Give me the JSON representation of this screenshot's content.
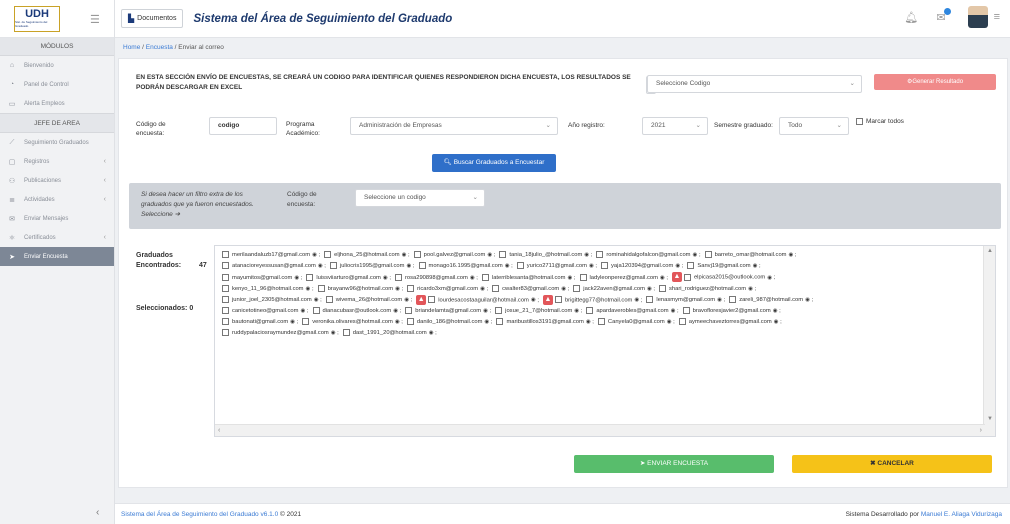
{
  "app": {
    "logo_text": "UDH",
    "logo_sub": "Sist. de Seguimiento del Graduado",
    "title": "Sistema del Área de Seguimiento del Graduado"
  },
  "topbar": {
    "doc_button": "Documentos"
  },
  "sidebar": {
    "header": "MÓDULOS",
    "items": [
      {
        "label": "Bienvenido",
        "icon": "home-icon"
      },
      {
        "label": "Panel de Control",
        "icon": "dashboard-icon"
      },
      {
        "label": "Alerta Empleos",
        "icon": "briefcase-icon"
      }
    ],
    "section": "JEFE DE AREA",
    "area_items": [
      {
        "label": "Seguimiento Graduados",
        "icon": "chart-icon",
        "chev": false
      },
      {
        "label": "Registros",
        "icon": "folder-icon",
        "chev": true
      },
      {
        "label": "Publicaciones",
        "icon": "users-icon",
        "chev": true
      },
      {
        "label": "Actividades",
        "icon": "list-icon",
        "chev": true
      },
      {
        "label": "Enviar Mensajes",
        "icon": "envelope-icon",
        "chev": false
      },
      {
        "label": "Certificados",
        "icon": "certificate-icon",
        "chev": true
      },
      {
        "label": "Enviar Encuesta",
        "icon": "send-icon",
        "chev": false,
        "active": true
      }
    ]
  },
  "breadcrumb": {
    "home": "Home",
    "encuesta": "Encuesta",
    "current": "Enviar al correo"
  },
  "intro": "EN ESTA SECCIÓN ENVÍO DE ENCUESTAS, SE CREARÁ UN CODIGO PARA IDENTIFICAR QUIENES RESPONDIERON DICHA ENCUESTA, LOS RESULTADOS SE PODRÁN DESCARGAR EN EXCEL",
  "codigo_select": "Seleccione Codigo",
  "generar_button": "Generar Resultado",
  "form": {
    "codigo_label": "Código de encuesta:",
    "codigo_value": "codigo",
    "programa_label": "Programa Académico:",
    "programa_value": "Administración de Empresas",
    "anio_label": "Año registro:",
    "anio_value": "2021",
    "semestre_label": "Semestre graduado:",
    "semestre_value": "Todo",
    "marcar_label": "Marcar todos",
    "buscar_button": "Buscar Graduados a Encuestar"
  },
  "filter": {
    "text": "Si desea hacer un filtro extra de los graduados que ya fueron encuestados. Seleccione ➔",
    "label": "Código de encuesta:",
    "select": "Seleccione un codigo"
  },
  "stats": {
    "encontrados_label": "Graduados Encontrados:",
    "encontrados_value": "47",
    "seleccionados_label": "Seleccionados:",
    "seleccionados_value": "0"
  },
  "emails": [
    [
      "merilaandaluzb17@gmail.com",
      "eljhona_25@hotmail.com",
      "pool.galvez@gmail.com",
      "tania_18julio_@hotmail.com",
      "rominahidalgofalcon@gmail.com",
      "barreto_omar@hotmail.com"
    ],
    [
      "atanacioreyessusan@gmail.com",
      "juliocris1995@gmail.com",
      "monago16.1995@gmail.com",
      "yurico2711@gmail.com",
      "yaja120394@gmail.com",
      "Sanvj19@gmail.com"
    ],
    [
      "mayumitos@gmail.com",
      "luissviiarturo@gmail.com",
      "rosa290898@gmail.com",
      "laterriblesanta@hotmail.com",
      "ladyleonperez@gmail.com",
      "!elpicasa2015@outlook.com"
    ],
    [
      "kenyo_11_96@hotmail.com",
      "brayanw96@hotmail.com",
      "ricardo3xm@gmail.com",
      "cwalter83@gmail.com",
      "jack22aven@gmail.com",
      "shari_rodriguez@hotmail.com"
    ],
    [
      "junior_joel_2305@hotmail.com",
      "wivema_26@hotmail.com",
      "!lourdesacostaaguilar@hotmail.com",
      "!brigittegg77@hotmail.com",
      "lenasmym@gmail.com",
      "zareli_987@hotmail.com"
    ],
    [
      "canicetotineo@gmail.com",
      "dianacubasr@outlook.com",
      "briandelamta@gmail.com",
      "josue_21_7@hotmail.com",
      "apardaverobles@gmail.com",
      "bravofloresjavier2@gmail.com"
    ],
    [
      "bautonati@gmail.com",
      "veronika.olivares@hotmail.com",
      "danilo_186@hotmail.com",
      "maribustillos3191@gmail.com",
      "Canyela0@gmail.com",
      "aymeechaveztorres@gmail.com"
    ],
    [
      "ruddypalaciosraymundez@gmail.com",
      "dast_1991_20@hotmail.com"
    ]
  ],
  "actions": {
    "send": "ENVIAR ENCUESTA",
    "cancel": "CANCELAR"
  },
  "footer": {
    "left": "Sistema del Área de Seguimiento del Graduado v6.1.0",
    "year": "© 2021",
    "right_prefix": "Sistema Desarrollado por",
    "author": "Manuel E. Aliaga Vidurizaga"
  }
}
